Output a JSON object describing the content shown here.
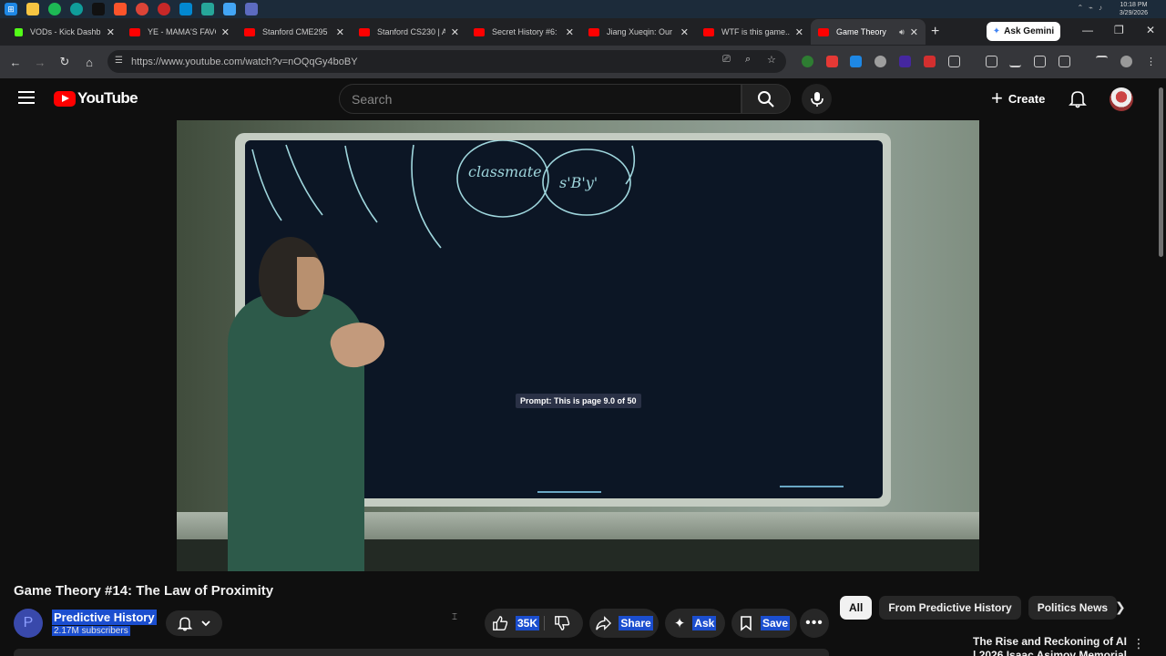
{
  "clock": {
    "time": "10:18 PM",
    "date": "3/29/2026"
  },
  "browser": {
    "tabs": [
      {
        "label": "VODs - Kick Dashb",
        "fav": "#53fc18",
        "active": false
      },
      {
        "label": "YE - MAMA'S FAVO",
        "fav": "#ff0000",
        "active": false
      },
      {
        "label": "Stanford CME295",
        "fav": "#ff0000",
        "active": false
      },
      {
        "label": "Stanford CS230 | A",
        "fav": "#ff0000",
        "active": false
      },
      {
        "label": "Secret History #6:",
        "fav": "#ff0000",
        "active": false
      },
      {
        "label": "Jiang Xueqin: Our",
        "fav": "#ff0000",
        "active": false
      },
      {
        "label": "WTF is this game...",
        "fav": "#ff0000",
        "active": false
      },
      {
        "label": "Game Theory",
        "fav": "#ff0000",
        "active": true
      }
    ],
    "ask_gemini": "Ask Gemini",
    "url": "https://www.youtube.com/watch?v=nOQqGy4boBY"
  },
  "header": {
    "logo_text": "YouTube",
    "search_placeholder": "Search",
    "create_label": "Create"
  },
  "player": {
    "caption": "Prompt: This is page 9.0 of 50",
    "board_words": [
      "classmate",
      "s'B'y'"
    ]
  },
  "video": {
    "title": "Game Theory #14: The Law of Proximity",
    "channel": "Predictive History",
    "channel_initial": "P",
    "subscribers": "2.17M subscribers",
    "likes": "35K",
    "share_label": "Share",
    "ask_label": "Ask",
    "save_label": "Save"
  },
  "chips": [
    "All",
    "From Predictive History",
    "Politics News"
  ],
  "related": {
    "title": "The Rise and Reckoning of AI | 2026 Isaac Asimov Memorial"
  },
  "colors": {
    "accent": "#ff0000",
    "highlight": "#1b4ecf",
    "background": "#0f0f0f"
  }
}
